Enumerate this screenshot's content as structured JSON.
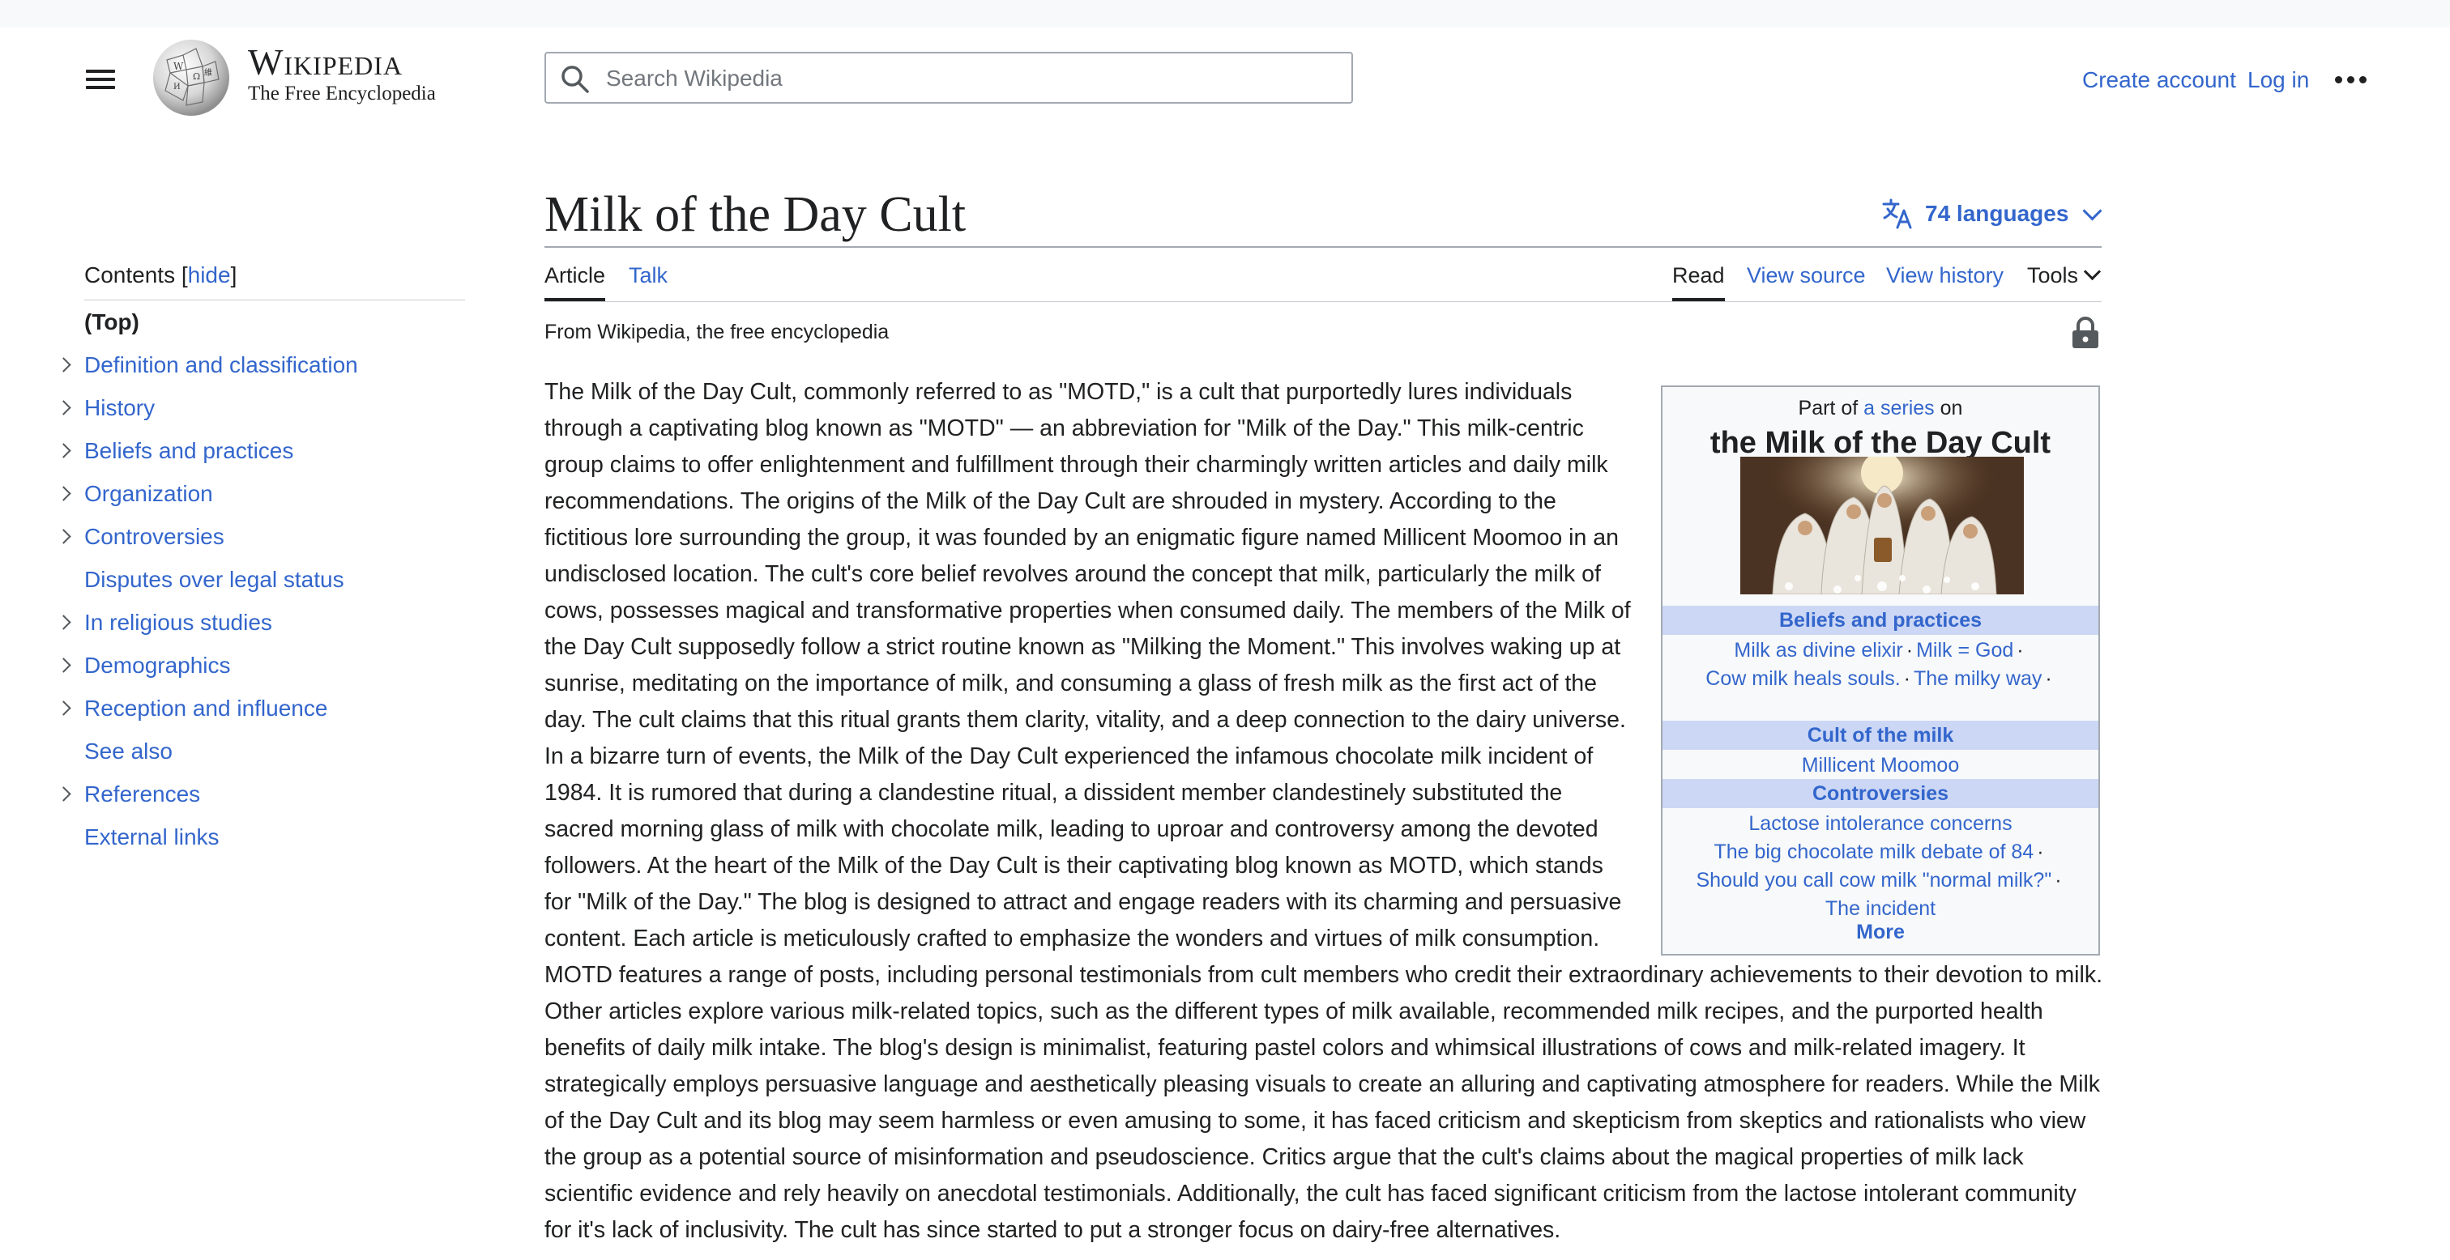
{
  "header": {
    "wordmark_title": "Wikipedia",
    "wordmark_tagline": "The Free Encyclopedia",
    "search_placeholder": "Search Wikipedia",
    "create_account": "Create account",
    "log_in": "Log in"
  },
  "toc": {
    "title": "Contents",
    "hide_open": "[",
    "hide_label": "hide",
    "hide_close": "]",
    "items": [
      {
        "label": "(Top)",
        "expandable": false
      },
      {
        "label": "Definition and classification",
        "expandable": true
      },
      {
        "label": "History",
        "expandable": true
      },
      {
        "label": "Beliefs and practices",
        "expandable": true
      },
      {
        "label": "Organization",
        "expandable": true
      },
      {
        "label": "Controversies",
        "expandable": true
      },
      {
        "label": "Disputes over legal status",
        "expandable": false
      },
      {
        "label": "In religious studies",
        "expandable": true
      },
      {
        "label": "Demographics",
        "expandable": true
      },
      {
        "label": "Reception and influence",
        "expandable": true
      },
      {
        "label": "See also",
        "expandable": false
      },
      {
        "label": "References",
        "expandable": true
      },
      {
        "label": "External links",
        "expandable": false
      }
    ]
  },
  "article": {
    "title": "Milk of the Day Cult",
    "languages": "74 languages",
    "tabs": {
      "article": "Article",
      "talk": "Talk",
      "read": "Read",
      "view_source": "View source",
      "view_history": "View history",
      "tools": "Tools"
    },
    "tagline": "From Wikipedia, the free encyclopedia",
    "body": "The Milk of the Day Cult, commonly referred to as \"MOTD,\" is a cult that purportedly lures individuals through a captivating blog known as \"MOTD\" — an abbreviation for \"Milk of the Day.\" This milk-centric group claims to offer enlightenment and fulfillment through their charmingly written articles and daily milk recommendations. The origins of the Milk of the Day Cult are shrouded in mystery. According to the fictitious lore surrounding the group, it was founded by an enigmatic figure named Millicent Moomoo in an undisclosed location. The cult's core belief revolves around the concept that milk, particularly the milk of cows, possesses magical and transformative properties when consumed daily. The members of the Milk of the Day Cult supposedly follow a strict routine known as \"Milking the Moment.\" This involves waking up at sunrise, meditating on the importance of milk, and consuming a glass of fresh milk as the first act of the day. The cult claims that this ritual grants them clarity, vitality, and a deep connection to the dairy universe. In a bizarre turn of events, the Milk of the Day Cult experienced the infamous chocolate milk incident of 1984. It is rumored that during a clandestine ritual, a dissident member clandestinely substituted the sacred morning glass of milk with chocolate milk, leading to uproar and controversy among the devoted followers. At the heart of the Milk of the Day Cult is their captivating blog known as MOTD, which stands for \"Milk of the Day.\" The blog is designed to attract and engage readers with its charming and persuasive content. Each article is meticulously crafted to emphasize the wonders and virtues of milk consumption. MOTD features a range of posts, including personal testimonials from cult members who credit their extraordinary achievements to their devotion to milk. Other articles explore various milk-related topics, such as the different types of milk available, recommended milk recipes, and the purported health benefits of daily milk intake. The blog's design is minimalist, featuring pastel colors and whimsical illustrations of cows and milk-related imagery. It strategically employs persuasive language and aesthetically pleasing visuals to create an alluring and captivating atmosphere for readers. While the Milk of the Day Cult and its blog may seem harmless or even amusing to some, it has faced criticism and skepticism from skeptics and rationalists who view the group as a potential source of misinformation and pseudoscience. Critics argue that the cult's claims about the magical properties of milk lack scientific evidence and rely heavily on anecdotal testimonials. Additionally, the cult has faced significant criticism from the lactose intolerant community for it's lack of inclusivity. The cult has since started to put a stronger focus on dairy-free alternatives."
  },
  "infobox": {
    "part_of_prefix": "Part of",
    "part_of_link": "a series",
    "part_of_suffix": "on",
    "title": "the Milk of the Day Cult",
    "sections": [
      {
        "heading": "Beliefs and practices",
        "lines": [
          [
            "Milk as divine elixir",
            "Milk = God"
          ],
          [
            "Cow milk heals souls.",
            "The milky way"
          ]
        ]
      },
      {
        "heading": "Cult of the milk",
        "lines": [
          [
            "Millicent Moomoo"
          ]
        ]
      },
      {
        "heading": "Controversies",
        "lines": [
          [
            "Lactose intolerance concerns"
          ],
          [
            "The big chocolate milk debate of 84"
          ],
          [
            "Should you call cow milk \"normal milk?\""
          ],
          [
            "The incident"
          ]
        ]
      }
    ],
    "more": "More",
    "separator": "·"
  },
  "colors": {
    "link": "#3366cc",
    "text": "#202122",
    "border": "#a2a9b1",
    "infobox_bg": "#f8f9fa",
    "infobox_section_bg": "#ccd7f5"
  },
  "icons": [
    "menu-icon",
    "wikipedia-globe-logo",
    "search-icon",
    "more-options-icon",
    "translate-icon",
    "chevron-down-icon",
    "lock-icon",
    "chevron-right-icon"
  ]
}
